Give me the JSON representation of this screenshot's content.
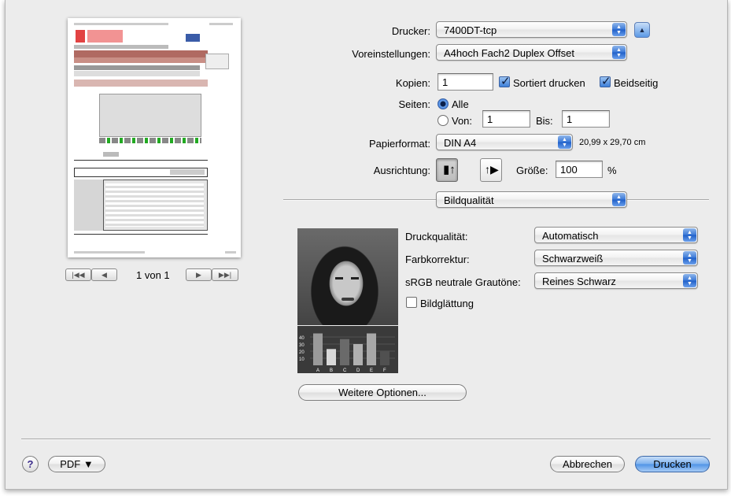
{
  "printer": {
    "label": "Drucker:",
    "value": "7400DT-tcp"
  },
  "presets": {
    "label": "Voreinstellungen:",
    "value": "A4hoch Fach2 Duplex Offset"
  },
  "copies": {
    "label": "Kopien:",
    "value": "1",
    "collated_label": "Sortiert drucken",
    "collated": true,
    "duplex_label": "Beidseitig",
    "duplex": true
  },
  "pages": {
    "label": "Seiten:",
    "all_label": "Alle",
    "from_label": "Von:",
    "from_value": "1",
    "to_label": "Bis:",
    "to_value": "1",
    "selected": "all"
  },
  "paper": {
    "label": "Papierformat:",
    "value": "DIN A4",
    "size_text": "20,99 x 29,70 cm"
  },
  "orientation": {
    "label": "Ausrichtung:",
    "scale_label": "Größe:",
    "scale_value": "100",
    "scale_unit": "%"
  },
  "section": {
    "value": "Bildqualität"
  },
  "quality": {
    "print_quality_label": "Druckqualität:",
    "print_quality": "Automatisch",
    "color_correction_label": "Farbkorrektur:",
    "color_correction": "Schwarzweiß",
    "srgb_label": "sRGB neutrale Grautöne:",
    "srgb": "Reines Schwarz",
    "smoothing_label": "Bildglättung",
    "smoothing": false
  },
  "more_options_label": "Weitere Optionen...",
  "preview": {
    "page_counter": "1 von 1",
    "thumb_bars": [
      {
        "label": "A",
        "value": 45
      },
      {
        "label": "B",
        "value": 23
      },
      {
        "label": "C",
        "value": 37
      },
      {
        "label": "D",
        "value": 30
      },
      {
        "label": "E",
        "value": 45
      },
      {
        "label": "F",
        "value": 20
      }
    ],
    "thumb_ticks": [
      "40",
      "30",
      "20",
      "10"
    ]
  },
  "footer": {
    "help": "?",
    "pdf_label": "PDF ▼",
    "cancel_label": "Abbrechen",
    "print_label": "Drucken"
  }
}
